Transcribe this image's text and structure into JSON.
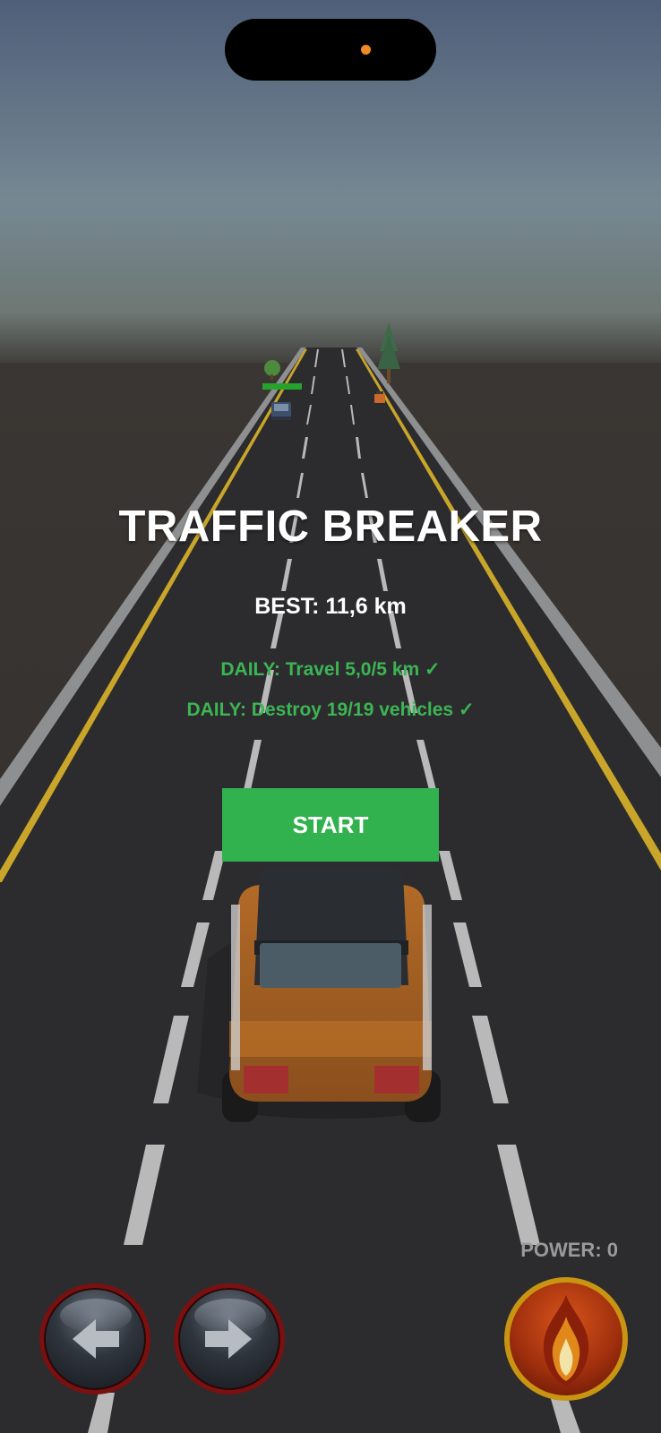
{
  "game": {
    "title": "TRAFFIC BREAKER",
    "best": "BEST: 11,6 km",
    "daily_quests": [
      "DAILY: Travel 5,0/5 km ✓",
      "DAILY: Destroy 19/19 vehicles ✓"
    ],
    "start_label": "START",
    "power_label": "POWER: 0"
  },
  "controls": {
    "left_icon": "arrow-left-icon",
    "right_icon": "arrow-right-icon",
    "boost_icon": "fire-icon"
  },
  "colors": {
    "accent_green": "#31b24e",
    "daily_text": "#3cb554",
    "road": "#2c2c2e",
    "lane_yellow": "#c9a52a",
    "player_car": "#c97a2a"
  }
}
